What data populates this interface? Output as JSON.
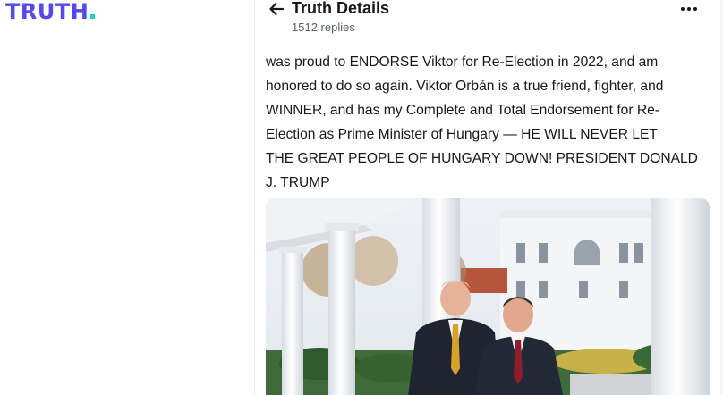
{
  "brand": {
    "logo_text": "TRUTH",
    "logo_color": "#5448ee",
    "dot_color": "#17d2c0"
  },
  "header": {
    "back_icon": "arrow-left-icon",
    "title": "Truth Details",
    "replies": "1512 replies",
    "more_icon": "more-horizontal-icon"
  },
  "post": {
    "lines": [
      "was proud to ENDORSE Viktor for Re-Election in 2022, and am",
      "honored to do so again. Viktor Orbán is a true friend, fighter, and",
      "WINNER, and has my Complete and Total Endorsement for Re-",
      "Election as Prime Minister of Hungary — HE WILL NEVER LET",
      "THE GREAT PEOPLE OF HUNGARY DOWN! PRESIDENT DONALD",
      "J. TRUMP"
    ],
    "media": {
      "type": "photo",
      "description_icon": "photo-image"
    }
  }
}
